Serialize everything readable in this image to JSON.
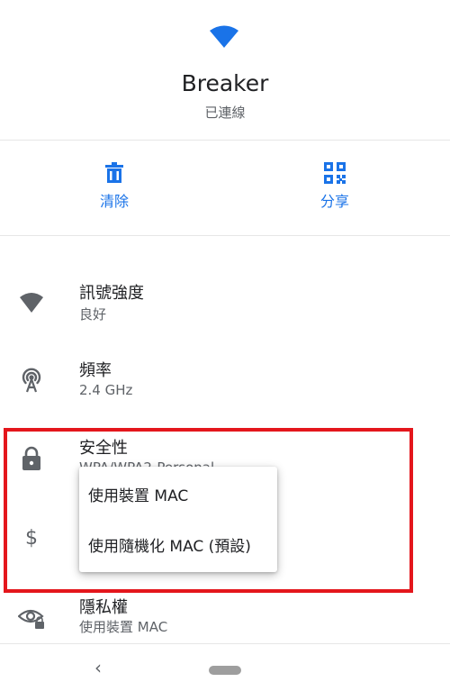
{
  "header": {
    "network_name": "Breaker",
    "status": "已連線"
  },
  "actions": [
    {
      "label": "清除",
      "icon": "trash-icon"
    },
    {
      "label": "分享",
      "icon": "qr-code-icon"
    }
  ],
  "details": [
    {
      "title": "訊號強度",
      "value": "良好",
      "icon": "wifi-signal-icon"
    },
    {
      "title": "頻率",
      "value": "2.4 GHz",
      "icon": "wifi-tower-icon"
    },
    {
      "title": "安全性",
      "value": "WPA/WPA2-Personal",
      "icon": "lock-icon"
    },
    {
      "title": "",
      "value": "",
      "icon": "dollar-icon"
    },
    {
      "title": "隱私權",
      "value": "使用裝置 MAC",
      "icon": "eye-privacy-icon"
    }
  ],
  "popup_menu": {
    "options": [
      "使用裝置 MAC",
      "使用隨機化 MAC (預設)"
    ]
  },
  "nav": {
    "back_glyph": "‹"
  },
  "colors": {
    "accent": "#1a73e8",
    "highlight": "#e4161c",
    "icon_gray": "#5f6368"
  }
}
